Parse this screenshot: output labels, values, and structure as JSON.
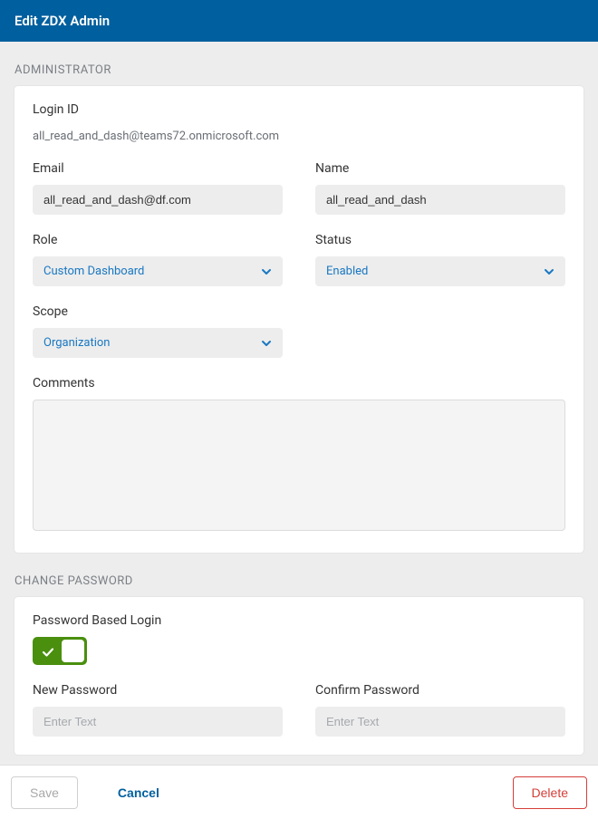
{
  "header": {
    "title": "Edit ZDX Admin"
  },
  "sections": {
    "administrator": {
      "label": "ADMINISTRATOR",
      "login_id_label": "Login ID",
      "login_id_value": "all_read_and_dash@teams72.onmicrosoft.com",
      "email_label": "Email",
      "email_value": "all_read_and_dash@df.com",
      "name_label": "Name",
      "name_value": "all_read_and_dash",
      "role_label": "Role",
      "role_value": "Custom Dashboard",
      "status_label": "Status",
      "status_value": "Enabled",
      "scope_label": "Scope",
      "scope_value": "Organization",
      "comments_label": "Comments",
      "comments_value": ""
    },
    "change_password": {
      "label": "CHANGE PASSWORD",
      "toggle_label": "Password Based Login",
      "toggle_on": true,
      "new_password_label": "New Password",
      "new_password_placeholder": "Enter Text",
      "confirm_password_label": "Confirm Password",
      "confirm_password_placeholder": "Enter Text"
    }
  },
  "footer": {
    "save": "Save",
    "cancel": "Cancel",
    "delete": "Delete"
  },
  "colors": {
    "header_bg": "#005f9e",
    "accent": "#1a78c2",
    "toggle_on": "#4a8f0e",
    "danger": "#d43f3a"
  }
}
